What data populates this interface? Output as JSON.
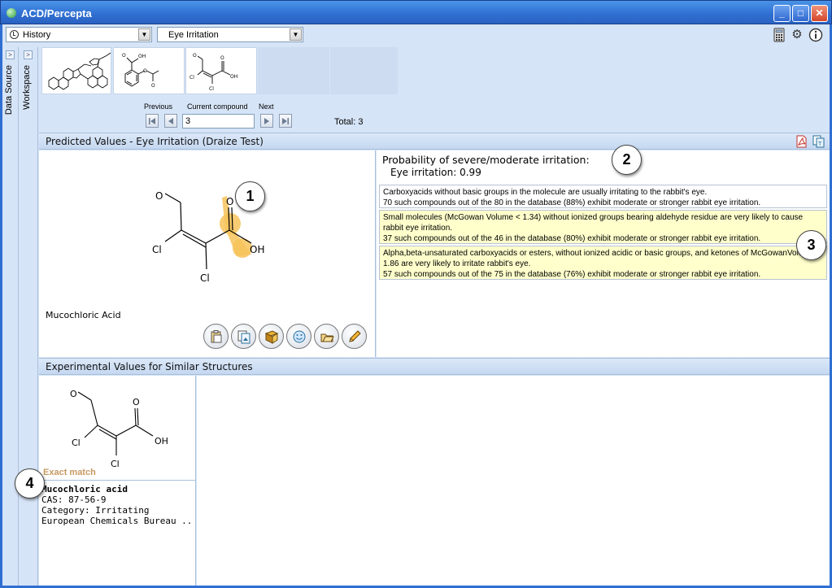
{
  "window": {
    "title": "ACD/Percepta"
  },
  "toolbar": {
    "history_label": "History",
    "module_label": "Eye Irritation"
  },
  "sidebar": {
    "tabs": [
      {
        "label": "Data Source"
      },
      {
        "label": "Workspace"
      }
    ]
  },
  "navigation": {
    "previous_label": "Previous",
    "current_label": "Current compound",
    "next_label": "Next",
    "current_value": "3",
    "total_text": "Total: 3"
  },
  "predicted": {
    "header": "Predicted Values - Eye Irritation (Draize Test)",
    "compound_name": "Mucochloric Acid",
    "probability_title": "Probability of severe/moderate irritation:",
    "probability_value": "Eye irritation: 0.99",
    "explanations": [
      {
        "line1": "Carboxyacids without basic groups in the molecule are usually irritating to the rabbit's eye.",
        "line2": "70 such compounds out of the 80 in the database (88%) exhibit moderate or stronger rabbit eye irritation.",
        "highlight": false
      },
      {
        "line1": "Small molecules (McGowan Volume < 1.34) without ionized groups bearing aldehyde residue are very likely to cause rabbit eye irritation.",
        "line2": " 37 such compounds out of the 46 in the database (80%) exhibit moderate or stronger rabbit eye irritation.",
        "highlight": true
      },
      {
        "line1": "Alpha,beta-unsaturated carboxyacids or esters, without ionized acidic or basic groups, and ketones of McGowanVolume < 1.86 are very likely to irritate rabbit's eye.",
        "line2": "57 such compounds out of the 75 in the database (76%) exhibit moderate or stronger rabbit eye irritation.",
        "highlight": true
      }
    ]
  },
  "experimental": {
    "header": "Experimental Values for Similar Structures",
    "match_label": "Exact match",
    "record": {
      "name": "Mucochloric acid",
      "cas": "CAS: 87-56-9",
      "category": "Category: Irritating",
      "source": "European Chemicals Bureau .."
    }
  },
  "callouts": [
    "1",
    "2",
    "3",
    "4"
  ],
  "atoms": {
    "O": "O",
    "OH": "OH",
    "Cl": "Cl"
  },
  "colors": {
    "highlight": "#f7c35a",
    "panel_bg": "#d6e4f7",
    "title_bar": "#2f6fd1",
    "exact_match": "#c79a63"
  },
  "icons": [
    "app-icon",
    "clock-icon",
    "calculator-icon",
    "gear-icon",
    "info-icon",
    "pdf-icon",
    "copy-icon",
    "clipboard-icon",
    "image-icon",
    "book-icon",
    "smiley-icon",
    "open-icon",
    "pencil-icon"
  ]
}
